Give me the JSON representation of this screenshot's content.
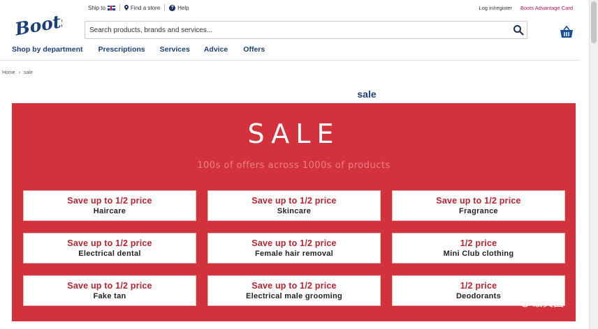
{
  "utility": {
    "ship_to": "Ship to",
    "find_store": "Find a store",
    "help": "Help",
    "login": "Log in/register",
    "advantage_card": "Boots Advantage Card"
  },
  "logo": {
    "text": "Boots"
  },
  "search": {
    "placeholder": "Search products, brands and services..."
  },
  "nav": {
    "items": [
      "Shop by department",
      "Prescriptions",
      "Services",
      "Advice",
      "Offers"
    ]
  },
  "breadcrumb": {
    "home": "Home",
    "separator": "›",
    "current": "sale"
  },
  "page": {
    "title": "sale"
  },
  "banner": {
    "title": "SALE",
    "subtitle": "100s of offers across 1000s of products",
    "cards": [
      {
        "offer": "Save up to 1/2 price",
        "category": "Haircare"
      },
      {
        "offer": "Save up to 1/2 price",
        "category": "Skincare"
      },
      {
        "offer": "Save up to 1/2 price",
        "category": "Fragrance"
      },
      {
        "offer": "Save up to 1/2 price",
        "category": "Electrical dental"
      },
      {
        "offer": "Save up to 1/2 price",
        "category": "Female hair removal"
      },
      {
        "offer": "1/2 price",
        "category": "Mini Club clothing"
      },
      {
        "offer": "Save up to 1/2 price",
        "category": "Fake tan"
      },
      {
        "offer": "Save up to 1/2 price",
        "category": "Electrical male grooming"
      },
      {
        "offer": "1/2 price",
        "category": "Deodorants"
      }
    ]
  },
  "watermark": {
    "text": "最英国"
  },
  "colors": {
    "brand_blue": "#1c3f7a",
    "sale_red": "#d2323c",
    "offer_red": "#b8242f",
    "advantage_pink": "#b3165a"
  }
}
